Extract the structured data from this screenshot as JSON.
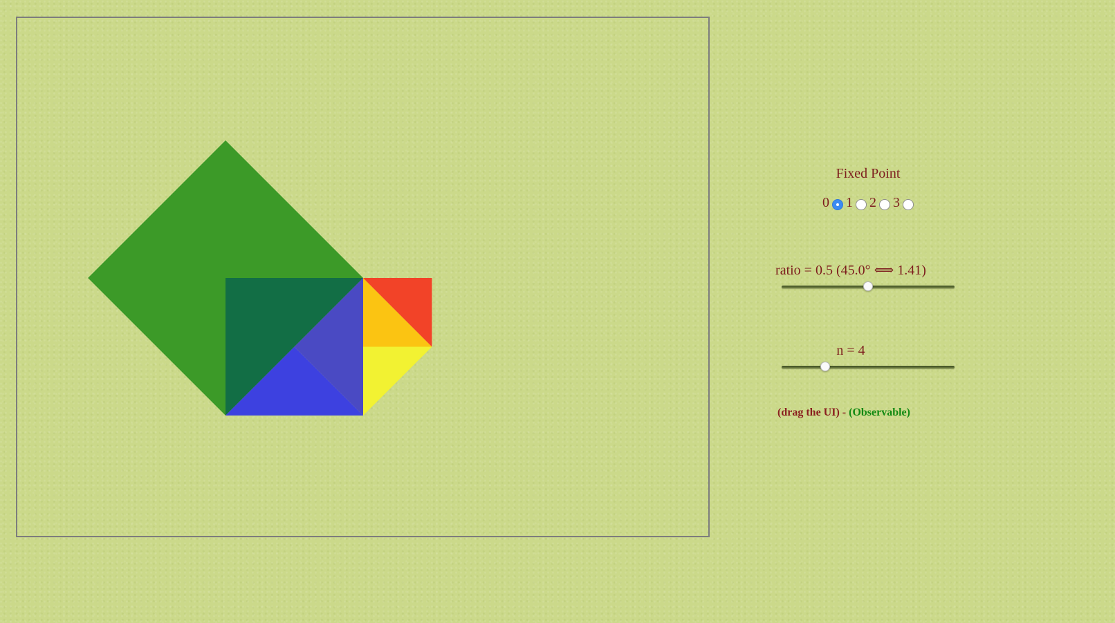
{
  "fixed_point": {
    "title": "Fixed Point",
    "options": [
      "0",
      "1",
      "2",
      "3"
    ],
    "selected": "0"
  },
  "ratio_slider": {
    "label": "ratio = 0.5 (45.0° ⟺ 1.41)",
    "value": 0.5
  },
  "n_slider": {
    "label": "n = 4",
    "value": 4
  },
  "footer": {
    "drag_text": "(drag the UI)",
    "separator": " - ",
    "observable_text": "(Observable)"
  },
  "colors": {
    "background": "#cbd98a",
    "frame_border": "#7d7d7d",
    "piece_1": "#3c9a28",
    "piece_2": "#126e45",
    "piece_3": "#3d41e0",
    "piece_4": "#4a4ac3",
    "piece_5": "#f2f232",
    "piece_6": "#fbc412",
    "piece_7": "#f24328",
    "text": "#7d1d1d",
    "link": "#138a13",
    "radio_selected": "#3b8bf2"
  }
}
